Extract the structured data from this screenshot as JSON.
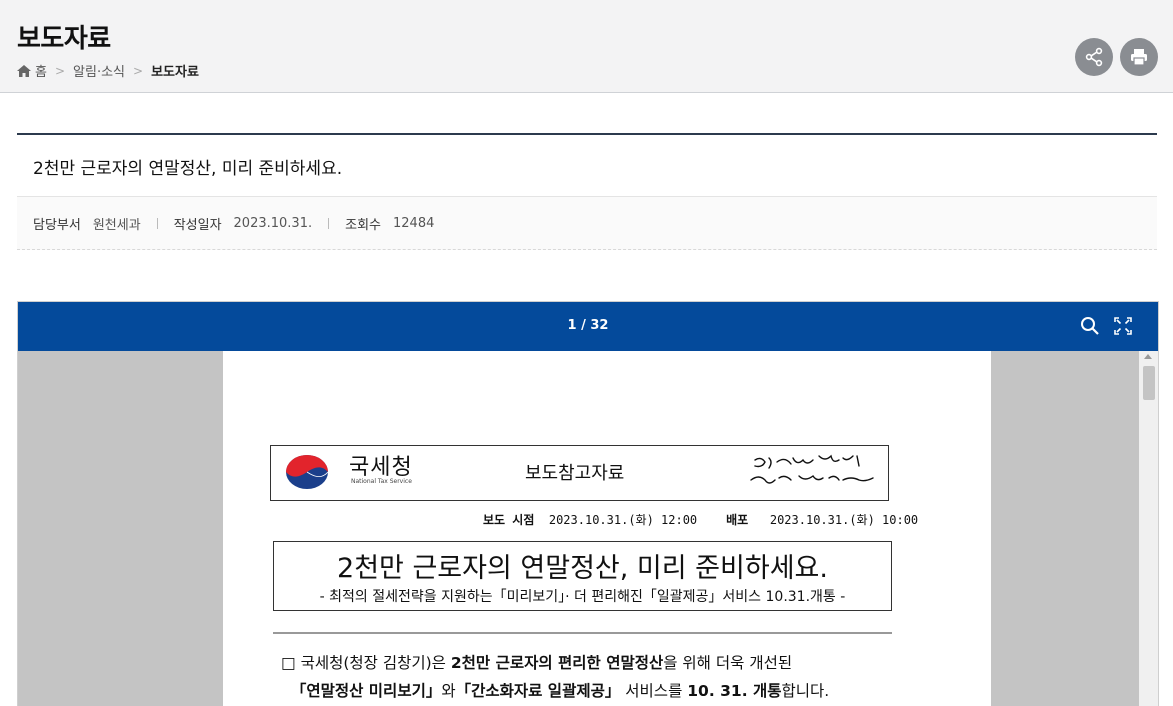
{
  "header": {
    "title": "보도자료",
    "breadcrumb": [
      "홈",
      "알림·소식",
      "보도자료"
    ],
    "share_icon": "share-icon",
    "print_icon": "print-icon"
  },
  "article": {
    "title": "2천만 근로자의 연말정산, 미리 준비하세요.",
    "meta": {
      "dept_label": "담당부서",
      "dept": "원천세과",
      "date_label": "작성일자",
      "date": "2023.10.31.",
      "views_label": "조회수",
      "views": "12484"
    }
  },
  "viewer": {
    "page_indicator": "1 / 32",
    "bar_color": "#044a9b",
    "document": {
      "agency_name": "국세청",
      "agency_eng": "National Tax Service",
      "doc_type": "보도참고자료",
      "release_label": "보도 시점",
      "release_time": "2023.10.31.(화) 12:00",
      "distribution_label": "배포",
      "distribution_time": "2023.10.31.(화) 10:00",
      "title": "2천만 근로자의 연말정산, 미리 준비하세요.",
      "subtitle": "- 최적의 절세전략을 지원하는「미리보기」· 더 편리해진「일괄제공」서비스 10.31.개통 -",
      "para_line1_a": "□ 국세청(청장 김창기)은 ",
      "para_line1_b": "2천만 근로자의 편리한 연말정산",
      "para_line1_c": "을 위해 더욱 개선된",
      "para_line2_a": "「연말정산 미리보기」",
      "para_line2_b": "와",
      "para_line2_c": "「간소화자료 일괄제공」",
      "para_line2_d": " 서비스를 ",
      "para_line2_e": "10. 31. 개통",
      "para_line2_f": "합니다."
    }
  }
}
